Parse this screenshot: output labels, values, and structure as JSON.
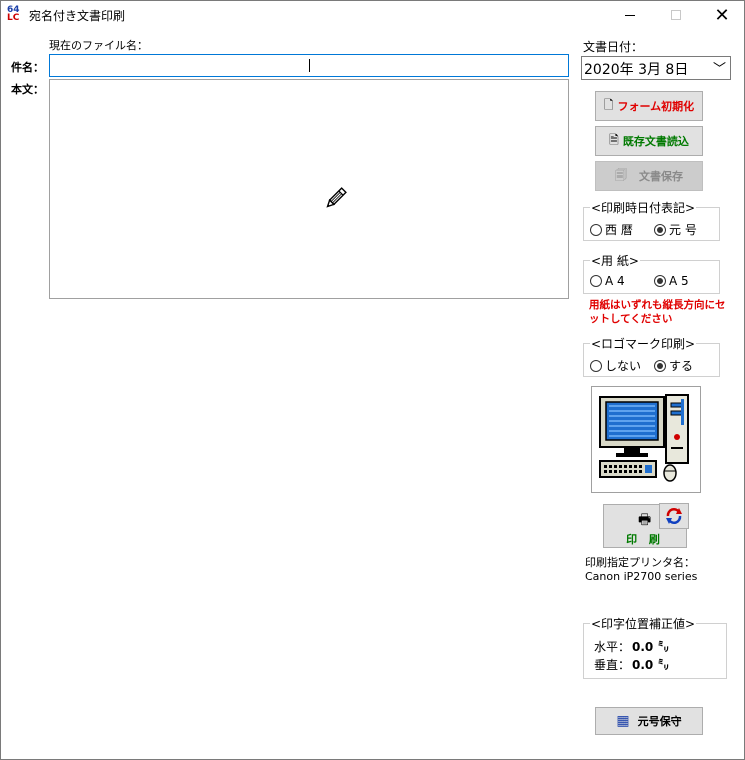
{
  "window": {
    "title": "宛名付き文書印刷",
    "app_icon_top": "64",
    "app_icon_bottom": "LC",
    "minimize_icon": "minimize-icon",
    "maximize_icon": "maximize-icon",
    "close_glyph": "✕"
  },
  "file": {
    "current_file_label": "現在のファイル名："
  },
  "subject": {
    "label": "件名：",
    "value": ""
  },
  "body": {
    "label": "本文：",
    "value": "",
    "pencil_icon": "pencil-icon"
  },
  "document_date": {
    "label": "文書日付：",
    "value": "2020年  3月  8日",
    "chevron": "﹀"
  },
  "buttons": {
    "form_init": "フォーム初期化",
    "load_existing": "既存文書読込",
    "save_document": "文書保存",
    "print": "印 刷",
    "era_preserve": "元号保守"
  },
  "date_notation": {
    "title": "<印刷時日付表記>",
    "options": [
      "西 暦",
      "元 号"
    ],
    "selected": "元 号"
  },
  "paper": {
    "title": "<用  紙>",
    "options": [
      "A 4",
      "A 5"
    ],
    "selected": "A 5",
    "warning": "用紙はいずれも縦長方向にセットしてください"
  },
  "logo_print": {
    "title": "<ロゴマーク印刷>",
    "options": [
      "しない",
      "する"
    ],
    "selected": "する"
  },
  "printer": {
    "label": "印刷指定プリンタ名：",
    "name": "Canon iP2700 series"
  },
  "print_position": {
    "title": "<印字位置補正値>",
    "horizontal_label": "水平：",
    "horizontal_value": "0.0 ㍉",
    "vertical_label": "垂直：",
    "vertical_value": "0.0 ㍉"
  },
  "colors": {
    "accent_border": "#0078d7",
    "red_text": "#e00000",
    "green_text": "#007a00"
  }
}
